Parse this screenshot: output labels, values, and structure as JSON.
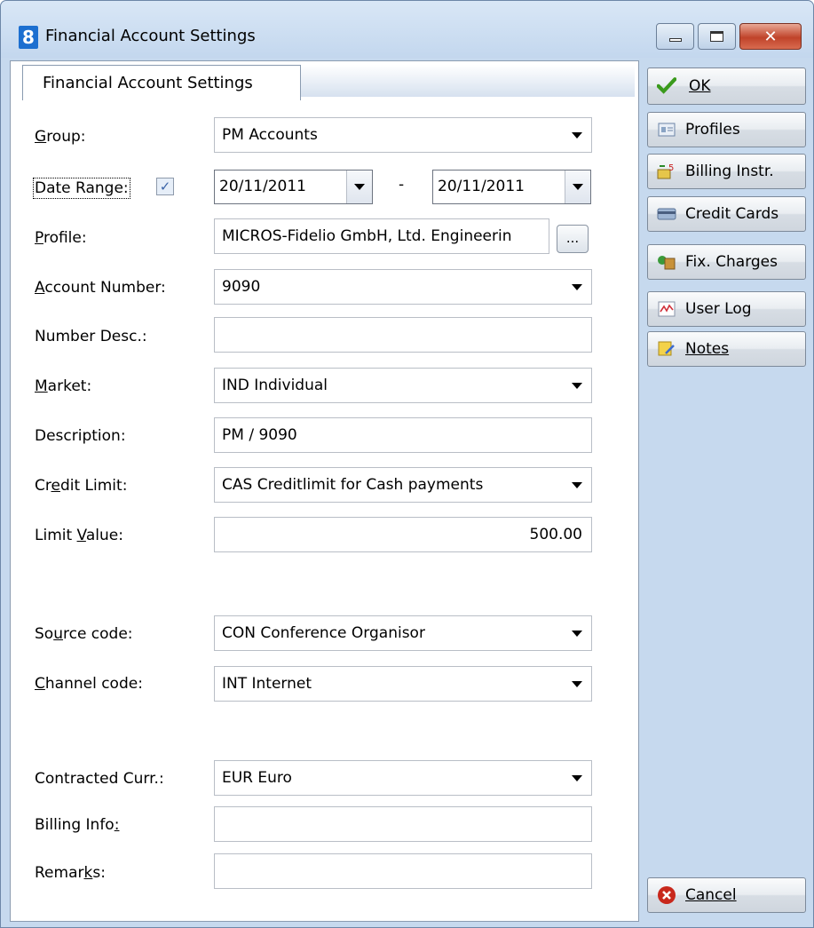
{
  "window": {
    "title": "Financial Account Settings",
    "close_glyph": "✕"
  },
  "tab": {
    "label": "Financial Account Settings"
  },
  "form": {
    "group": {
      "label": "Group:",
      "value": "PM  Accounts"
    },
    "date_range": {
      "label": "Date Range:",
      "checked": true,
      "check_glyph": "✓",
      "from": "20/11/2011",
      "separator": "-",
      "to": "20/11/2011"
    },
    "profile": {
      "label": "Profile:",
      "value": "MICROS-Fidelio GmbH, Ltd. Engineerin",
      "browse_label": "..."
    },
    "account_number": {
      "label": "Account Number:",
      "value": "9090"
    },
    "number_desc": {
      "label": "Number Desc.:",
      "value": ""
    },
    "market": {
      "label": "Market:",
      "value": "IND  Individual"
    },
    "description": {
      "label": "Description:",
      "value": "PM / 9090"
    },
    "credit_limit": {
      "label": "Credit Limit:",
      "value": "CAS  Creditlimit for Cash payments"
    },
    "limit_value": {
      "label": "Limit Value:",
      "value": "500.00"
    },
    "source_code": {
      "label": "Source code:",
      "value": "CON  Conference Organisor"
    },
    "channel_code": {
      "label": "Channel code:",
      "value": "INT  Internet"
    },
    "contracted_curr": {
      "label": "Contracted Curr.:",
      "value": "EUR  Euro"
    },
    "billing_info": {
      "label": "Billing Info:",
      "value": ""
    },
    "remarks": {
      "label": "Remarks:",
      "value": ""
    }
  },
  "sidebar": {
    "ok": {
      "label": "OK",
      "icon": "checkmark-icon"
    },
    "profiles": {
      "label": "Profiles",
      "icon": "profile-card-icon"
    },
    "billing_instr": {
      "label": "Billing Instr.",
      "icon": "billing-icon"
    },
    "credit_cards": {
      "label": "Credit Cards",
      "icon": "credit-card-icon"
    },
    "fix_charges": {
      "label": "Fix. Charges",
      "icon": "charges-icon"
    },
    "user_log": {
      "label": "User Log",
      "icon": "chart-icon"
    },
    "notes": {
      "label": "Notes",
      "icon": "notes-icon"
    },
    "cancel": {
      "label": "Cancel",
      "icon": "cancel-icon",
      "glyph": "✕"
    }
  },
  "colors": {
    "accent": "#c6d9ee",
    "ok_green": "#3a9a1c",
    "cancel_red": "#c8281c"
  }
}
